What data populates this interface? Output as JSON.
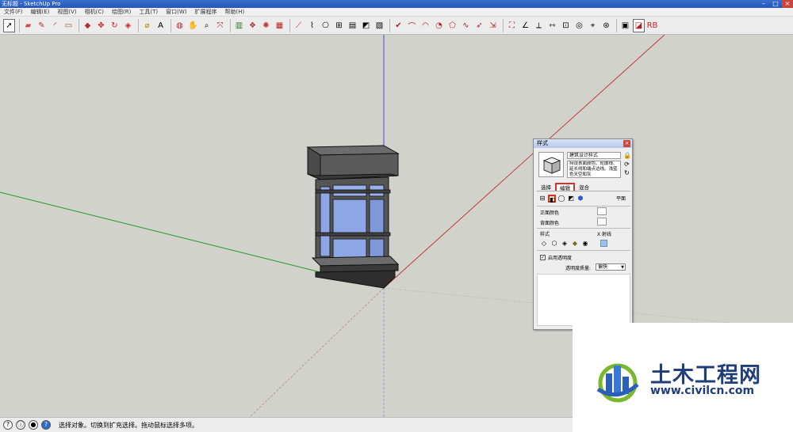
{
  "window": {
    "title": "无标题 - SketchUp Pro"
  },
  "menu": [
    "文件(F)",
    "编辑(E)",
    "视图(V)",
    "相机(C)",
    "绘图(R)",
    "工具(T)",
    "窗口(W)",
    "扩展程序",
    "帮助(H)"
  ],
  "toolbar": {
    "icons": [
      "select-icon",
      "eraser-icon",
      "pencil-icon",
      "arc-icon",
      "rectangle-icon",
      "push-pull-icon",
      "move-icon",
      "rotate-icon",
      "offset-icon",
      "tape-measure-icon",
      "text-icon",
      "orbit-icon",
      "pan-icon",
      "zoom-icon",
      "zoom-extents-icon",
      "section-icon",
      "components-icon",
      "materials-icon",
      "styles-icon"
    ]
  },
  "styles_panel": {
    "title": "样式",
    "close": "×",
    "style_name": "建筑设计样式",
    "style_desc": "持设表面颜色。轮廓线、延长线和端点边线。浅蓝色天空和灰",
    "tabs": [
      "选择",
      "编辑",
      "混合"
    ],
    "active_tab": "编辑",
    "plane_label": "平面",
    "front_color_label": "正面颜色",
    "back_color_label": "背面颜色",
    "style_label": "样式",
    "xray_label": "X 射线",
    "transparency_label": "启用透明度",
    "transparency_checked": "✓",
    "quality_label": "透明度质量:",
    "quality_value": "偏快"
  },
  "status": {
    "text": "选择对象。切换到扩充选择。拖动鼠标选择多项。"
  },
  "watermark": {
    "title": "土木工程网",
    "url": "www.civilcn.com"
  },
  "colors": {
    "red_axis": "#c23a3a",
    "green_axis": "#1f9a1f",
    "blue_axis": "#3a3ac2",
    "highlight": "#d83030",
    "glass": "#8ea6e6"
  }
}
